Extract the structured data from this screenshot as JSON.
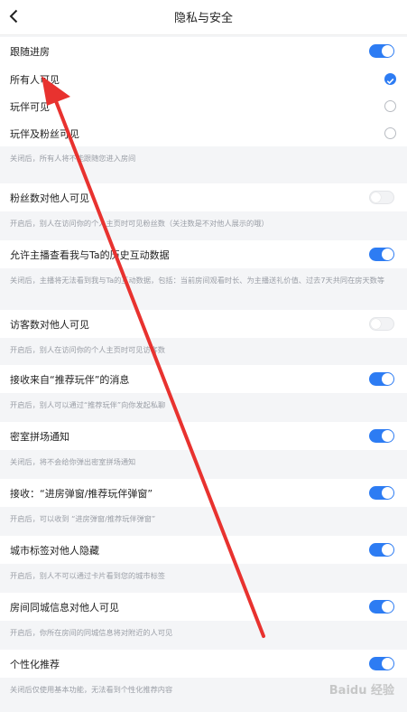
{
  "header": {
    "title": "隐私与安全",
    "back_icon": "chevron-left-icon"
  },
  "rows": {
    "follow": {
      "label": "跟随进房",
      "state": "on"
    },
    "everyone": {
      "label": "所有人可见",
      "state": "checked"
    },
    "partners": {
      "label": "玩伴可见",
      "state": "unchecked"
    },
    "partners_fans": {
      "label": "玩伴及粉丝可见",
      "state": "unchecked"
    },
    "follow_desc": "关闭后，所有人将不能跟随您进入房间",
    "fans_count": {
      "label": "粉丝数对他人可见",
      "state": "off",
      "desc": "开启后，别人在访问你的个人主页时可见粉丝数（关注数是不对他人展示的哦）"
    },
    "host_view": {
      "label": "允许主播查看我与Ta的历史互动数据",
      "state": "on",
      "desc": "关闭后，主播将无法看到我与Ta的互动数据，包括：当前房间观看时长、为主播送礼价值、过去7天共同在房天数等"
    },
    "visitors": {
      "label": "访客数对他人可见",
      "state": "off",
      "desc": "开启后，别人在访问你的个人主页时可见访客数"
    },
    "recommend_msg": {
      "label": "接收来自“推荐玩伴”的消息",
      "state": "on",
      "desc": "开启后，别人可以通过“推荐玩伴”向你发起私聊"
    },
    "escape_room": {
      "label": "密室拼场通知",
      "state": "on",
      "desc": "关闭后，将不会给你弹出密室拼场通知"
    },
    "popup": {
      "label": "接收：“进房弹窗/推荐玩伴弹窗”",
      "state": "on",
      "desc": "开启后，可以收到 “进房弹窗/推荐玩伴弹窗”"
    },
    "city_tag": {
      "label": "城市标签对他人隐藏",
      "state": "on",
      "desc": "开启后，别人不可以通过卡片看到您的城市标签"
    },
    "room_city": {
      "label": "房间同城信息对他人可见",
      "state": "on",
      "desc": "开启后，你所在房间的同城信息将对附近的人可见"
    },
    "personalized": {
      "label": "个性化推荐",
      "state": "on",
      "desc": "关闭后仅使用基本功能，无法看到个性化推荐内容"
    }
  },
  "watermark": "Baidu 经验",
  "colors": {
    "accent": "#2d7cf3",
    "annotation_arrow": "#e8322f"
  }
}
